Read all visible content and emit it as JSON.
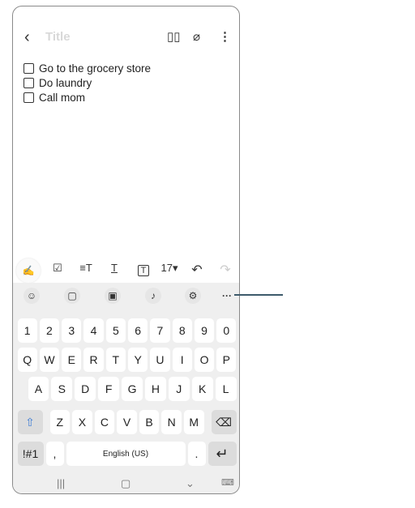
{
  "note": {
    "title_placeholder": "Title",
    "checklist": [
      {
        "label": "Go to the grocery store",
        "checked": false
      },
      {
        "label": "Do laundry",
        "checked": false
      },
      {
        "label": "Call mom",
        "checked": false
      }
    ]
  },
  "header_icons": {
    "back": "‹",
    "reading_mode": "📖",
    "attach": "📎",
    "more": "⋮"
  },
  "toolbar": {
    "pen": "✍",
    "checkbox": "☑",
    "text_style": "≡T",
    "underline_text": "T",
    "text_box": "🅃",
    "font_size": "17▾",
    "undo": "↶",
    "redo": "↷"
  },
  "kb_tools": {
    "emoji": "☺",
    "clipboard": "▢",
    "sticker": "▣",
    "voice": "🎙",
    "settings": "⚙",
    "more": "···"
  },
  "keyboard": {
    "row1": [
      "1",
      "2",
      "3",
      "4",
      "5",
      "6",
      "7",
      "8",
      "9",
      "0"
    ],
    "row2": [
      "Q",
      "W",
      "E",
      "R",
      "T",
      "Y",
      "U",
      "I",
      "O",
      "P"
    ],
    "row3": [
      "A",
      "S",
      "D",
      "F",
      "G",
      "H",
      "J",
      "K",
      "L"
    ],
    "row4": [
      "Z",
      "X",
      "C",
      "V",
      "B",
      "N",
      "M"
    ],
    "shift": "⇧",
    "backspace": "⌫",
    "symbols": "!#1",
    "comma": ",",
    "space": "English (US)",
    "period": ".",
    "enter": "↵"
  },
  "navbar": {
    "recents": "|||",
    "home": "▢",
    "back": "⌄",
    "keyboard": "⌨"
  }
}
